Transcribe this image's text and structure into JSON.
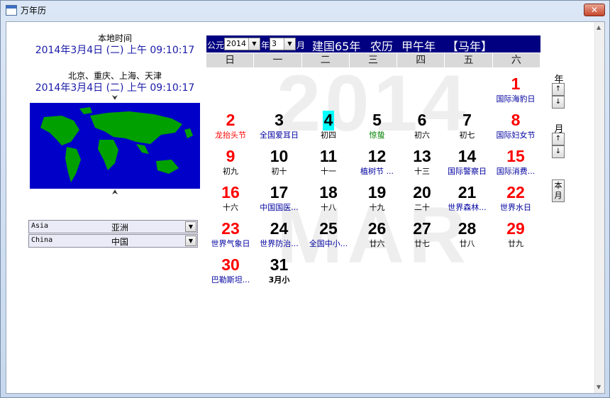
{
  "window": {
    "title": "万年历",
    "close_label": "✕"
  },
  "left": {
    "local_label": "本地时间",
    "local_time": "2014年3月4日 (二) 上午 09:10:17",
    "city_label": "北京、重庆、上海、天津",
    "city_time": "2014年3月4日 (二) 上午 09:10:17",
    "map_top_marker": "⮟",
    "map_bottom_marker": "⮝",
    "continent": {
      "en": "Asia",
      "zh": "亚洲"
    },
    "country": {
      "en": "China",
      "zh": "中国"
    }
  },
  "header": {
    "gongyuan": "公元",
    "year_value": "2014",
    "year_unit": "年",
    "month_value": "3",
    "month_unit": "月",
    "era": "建国65年",
    "lunar": "农历",
    "ganzhi": "甲午年",
    "zodiac": "【马年】"
  },
  "weekdays": [
    "日",
    "一",
    "二",
    "三",
    "四",
    "五",
    "六"
  ],
  "watermark": {
    "year": "2014",
    "month": "MAR"
  },
  "days": [
    {
      "d": "1",
      "sub": "国际海豹日",
      "dc": "red",
      "sc": "blue"
    },
    {
      "d": "2",
      "sub": "龙抬头节",
      "dc": "red",
      "sc": "red"
    },
    {
      "d": "3",
      "sub": "全国爱耳日",
      "dc": "black",
      "sc": "blue"
    },
    {
      "d": "4",
      "sub": "初四",
      "dc": "black",
      "sc": "black",
      "sel": true
    },
    {
      "d": "5",
      "sub": "惊蛰",
      "dc": "black",
      "sc": "green"
    },
    {
      "d": "6",
      "sub": "初六",
      "dc": "black",
      "sc": "black"
    },
    {
      "d": "7",
      "sub": "初七",
      "dc": "black",
      "sc": "black"
    },
    {
      "d": "8",
      "sub": "国际妇女节",
      "dc": "red",
      "sc": "blue"
    },
    {
      "d": "9",
      "sub": "初九",
      "dc": "red",
      "sc": "black"
    },
    {
      "d": "10",
      "sub": "初十",
      "dc": "black",
      "sc": "black"
    },
    {
      "d": "11",
      "sub": "十一",
      "dc": "black",
      "sc": "black"
    },
    {
      "d": "12",
      "sub": "植树节 ...",
      "dc": "black",
      "sc": "blue"
    },
    {
      "d": "13",
      "sub": "十三",
      "dc": "black",
      "sc": "black"
    },
    {
      "d": "14",
      "sub": "国际警察日",
      "dc": "black",
      "sc": "blue"
    },
    {
      "d": "15",
      "sub": "国际消费...",
      "dc": "red",
      "sc": "blue"
    },
    {
      "d": "16",
      "sub": "十六",
      "dc": "red",
      "sc": "black"
    },
    {
      "d": "17",
      "sub": "中国国医...",
      "dc": "black",
      "sc": "blue"
    },
    {
      "d": "18",
      "sub": "十八",
      "dc": "black",
      "sc": "black"
    },
    {
      "d": "19",
      "sub": "十九",
      "dc": "black",
      "sc": "black"
    },
    {
      "d": "20",
      "sub": "二十",
      "dc": "black",
      "sc": "black"
    },
    {
      "d": "21",
      "sub": "世界森林...",
      "dc": "black",
      "sc": "blue"
    },
    {
      "d": "22",
      "sub": "世界水日",
      "dc": "red",
      "sc": "blue"
    },
    {
      "d": "23",
      "sub": "世界气象日",
      "dc": "red",
      "sc": "blue"
    },
    {
      "d": "24",
      "sub": "世界防治...",
      "dc": "black",
      "sc": "blue"
    },
    {
      "d": "25",
      "sub": "全国中小...",
      "dc": "black",
      "sc": "blue"
    },
    {
      "d": "26",
      "sub": "廿六",
      "dc": "black",
      "sc": "black"
    },
    {
      "d": "27",
      "sub": "廿七",
      "dc": "black",
      "sc": "black"
    },
    {
      "d": "28",
      "sub": "廿八",
      "dc": "black",
      "sc": "black"
    },
    {
      "d": "29",
      "sub": "廿九",
      "dc": "red",
      "sc": "black"
    },
    {
      "d": "30",
      "sub": "巴勒斯坦...",
      "dc": "red",
      "sc": "blue"
    },
    {
      "d": "31",
      "sub": "3月小",
      "dc": "black",
      "sc": "black",
      "sbold": true
    }
  ],
  "first_weekday_index": 6,
  "side": {
    "year_label": "年",
    "month_label": "月",
    "up": "↑",
    "down": "↓",
    "today": "本月"
  }
}
